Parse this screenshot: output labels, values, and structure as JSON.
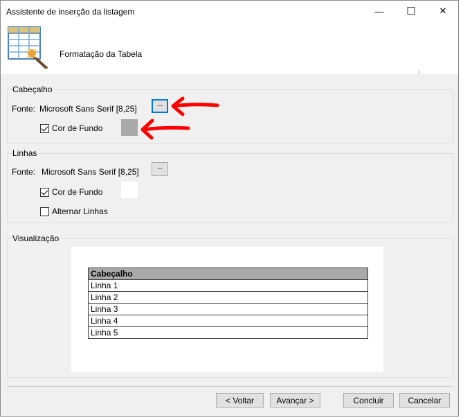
{
  "window": {
    "title": "Assistente de inserção da listagem",
    "minimize_glyph": "—",
    "maximize_glyph": "☐",
    "close_glyph": "✕"
  },
  "header": {
    "title": "Formatação da Tabela",
    "icon": "table-wizard-icon"
  },
  "cabecalho": {
    "group_label": "Cabeçalho",
    "fonte_label": "Fonte:",
    "fonte_value": "Microsoft Sans Serif [8,25]",
    "font_button": "...",
    "cor_de_fundo_label": "Cor de Fundo",
    "cor_de_fundo_checked": true,
    "swatch_color": "#a9a9a9"
  },
  "linhas": {
    "group_label": "Linhas",
    "fonte_label": "Fonte:",
    "fonte_value": "Microsoft Sans Serif [8,25]",
    "font_button": "...",
    "cor_de_fundo_label": "Cor de Fundo",
    "cor_de_fundo_checked": true,
    "swatch_color": "#ffffff",
    "alternar_label": "Alternar Linhas",
    "alternar_checked": false
  },
  "visualizacao": {
    "group_label": "Visualização",
    "header_cell": "Cabeçalho",
    "rows": [
      "Linha 1",
      "Linha 2",
      "Linha 3",
      "Linha 4",
      "Linha 5"
    ]
  },
  "footer": {
    "voltar": "< Voltar",
    "avancar": "Avançar >",
    "concluir": "Concluir",
    "cancelar": "Cancelar"
  },
  "annotation_color": "#ff0000"
}
